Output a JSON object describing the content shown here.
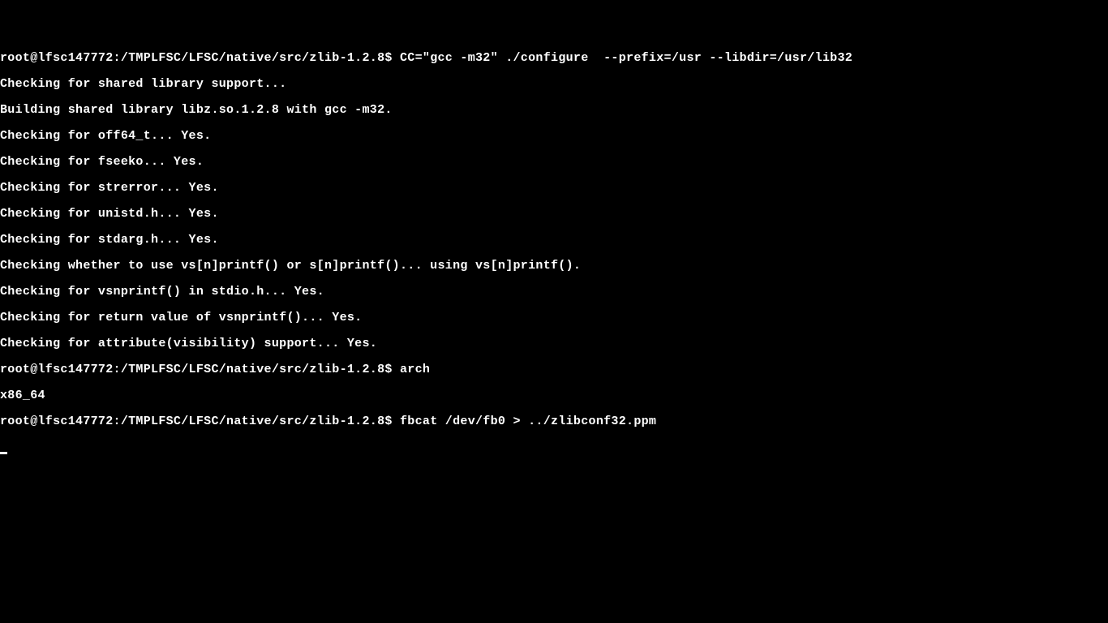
{
  "terminal": {
    "prompt1": "root@lfsc147772:/TMPLFSC/LFSC/native/src/zlib-1.2.8$ ",
    "cmd1": "CC=\"gcc -m32\" ./configure  --prefix=/usr --libdir=/usr/lib32",
    "out1": "Checking for shared library support...",
    "out2": "Building shared library libz.so.1.2.8 with gcc -m32.",
    "out3": "Checking for off64_t... Yes.",
    "out4": "Checking for fseeko... Yes.",
    "out5": "Checking for strerror... Yes.",
    "out6": "Checking for unistd.h... Yes.",
    "out7": "Checking for stdarg.h... Yes.",
    "out8": "Checking whether to use vs[n]printf() or s[n]printf()... using vs[n]printf().",
    "out9": "Checking for vsnprintf() in stdio.h... Yes.",
    "out10": "Checking for return value of vsnprintf()... Yes.",
    "out11": "Checking for attribute(visibility) support... Yes.",
    "prompt2": "root@lfsc147772:/TMPLFSC/LFSC/native/src/zlib-1.2.8$ ",
    "cmd2": "arch",
    "out12": "x86_64",
    "prompt3": "root@lfsc147772:/TMPLFSC/LFSC/native/src/zlib-1.2.8$ ",
    "cmd3": "fbcat /dev/fb0 > ../zlibconf32.ppm"
  }
}
